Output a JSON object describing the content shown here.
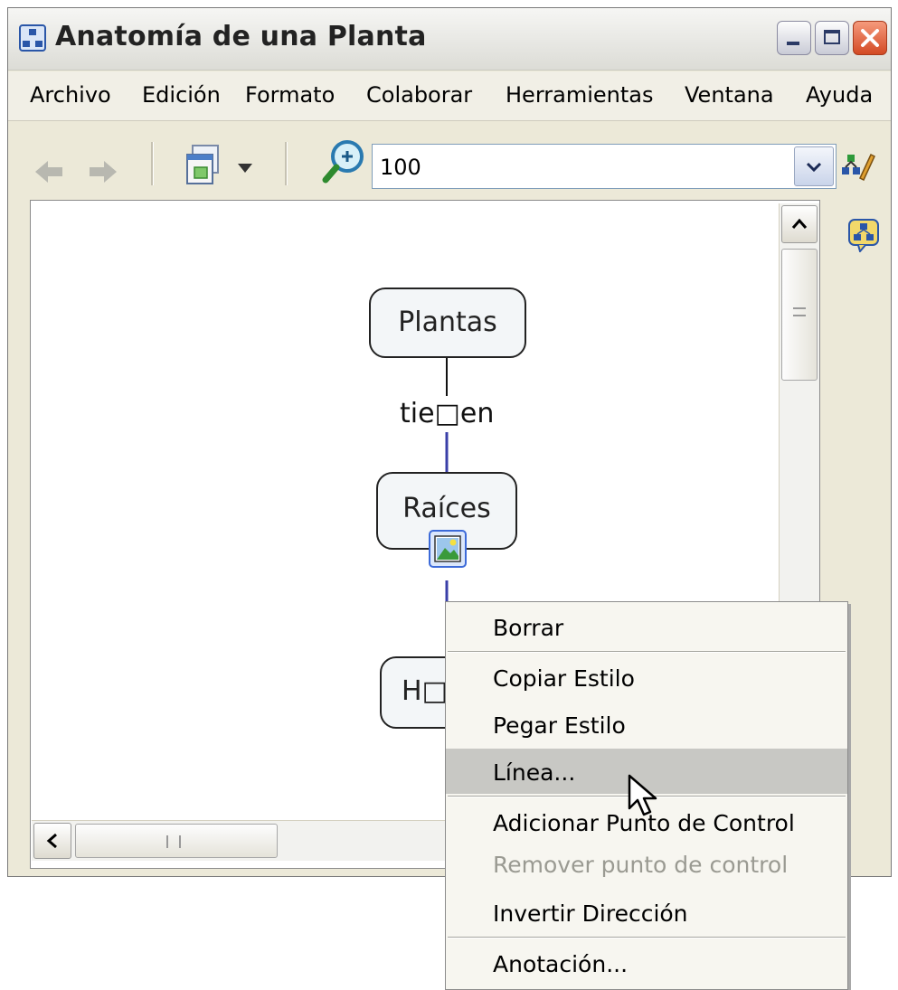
{
  "window": {
    "title": "Anatomía de una Planta"
  },
  "menubar": {
    "items": [
      "Archivo",
      "Edición",
      "Formato",
      "Colaborar",
      "Herramientas",
      "Ventana",
      "Ayuda"
    ]
  },
  "toolbar": {
    "zoom_value": "100"
  },
  "map": {
    "concept_top": "Plantas",
    "link_label": "tie□en",
    "concept_middle": "Raíces",
    "concept_bottom": "H□"
  },
  "context_menu": {
    "items": [
      {
        "label": "Borrar",
        "enabled": true
      },
      {
        "label": "Copiar Estilo",
        "enabled": true
      },
      {
        "label": "Pegar Estilo",
        "enabled": true
      },
      {
        "label": "Línea...",
        "enabled": true,
        "highlighted": true
      },
      {
        "label": "Adicionar Punto de Control",
        "enabled": true
      },
      {
        "label": "Remover punto de control",
        "enabled": false
      },
      {
        "label": "Invertir Dirección",
        "enabled": true
      },
      {
        "label": "Anotación...",
        "enabled": true
      }
    ]
  },
  "colors": {
    "link_line": "#3a3fa8",
    "menu_highlight": "#c8c8c4",
    "close_button": "#d34a24"
  }
}
